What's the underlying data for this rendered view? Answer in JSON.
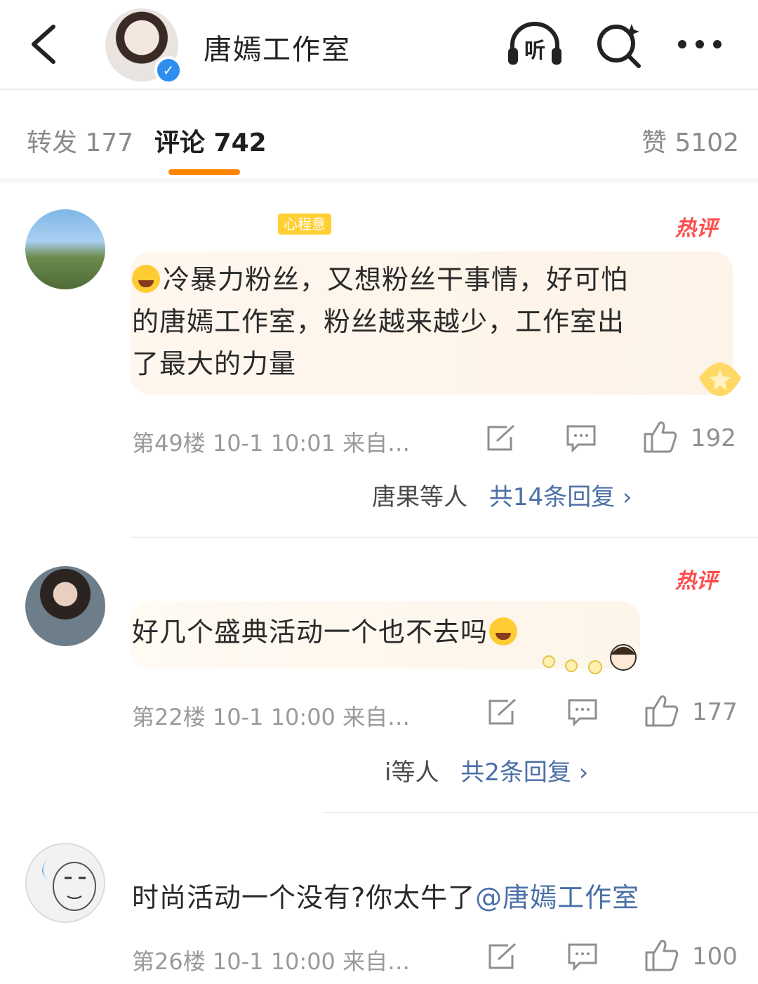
{
  "header": {
    "title": "唐嫣工作室",
    "verified_mark": "✓",
    "icons": [
      "back-arrow-icon",
      "listen-headphones-icon",
      "search-sparkle-icon",
      "more-dots-icon"
    ],
    "listen_label": "听"
  },
  "tabs": [
    {
      "label": "转发 177",
      "active": false
    },
    {
      "label": "评论 742",
      "active": true
    },
    {
      "label": "赞 5102",
      "active": false
    }
  ],
  "comments": [
    {
      "badge": "心程意",
      "hot_label": "热评",
      "text_lines": [
        "冷暴力粉丝，又想粉丝干事情，好可怕",
        "的唐嫣工作室，粉丝越来越少，工作室出",
        "了最大的力量"
      ],
      "meta": "第49楼 10-1 10:01 来自…",
      "likes": "192",
      "replies_prefix": "唐果等人",
      "replies_label": "共14条回复 ›"
    },
    {
      "hot_label": "热评",
      "text": "好几个盛典活动一个也不去吗",
      "meta": "第22楼 10-1 10:00 来自…",
      "likes": "177",
      "replies_prefix": "i等人",
      "replies_label": "共2条回复 ›"
    },
    {
      "text": "时尚活动一个没有?你太牛了",
      "mention": "@唐嫣工作室",
      "meta": "第26楼 10-1 10:00 来自…",
      "likes": "100"
    }
  ],
  "colors": {
    "accent": "#ff8200",
    "link": "#4b6fa8",
    "hot": "#ff4d4d",
    "meta": "#9a9a9a"
  }
}
